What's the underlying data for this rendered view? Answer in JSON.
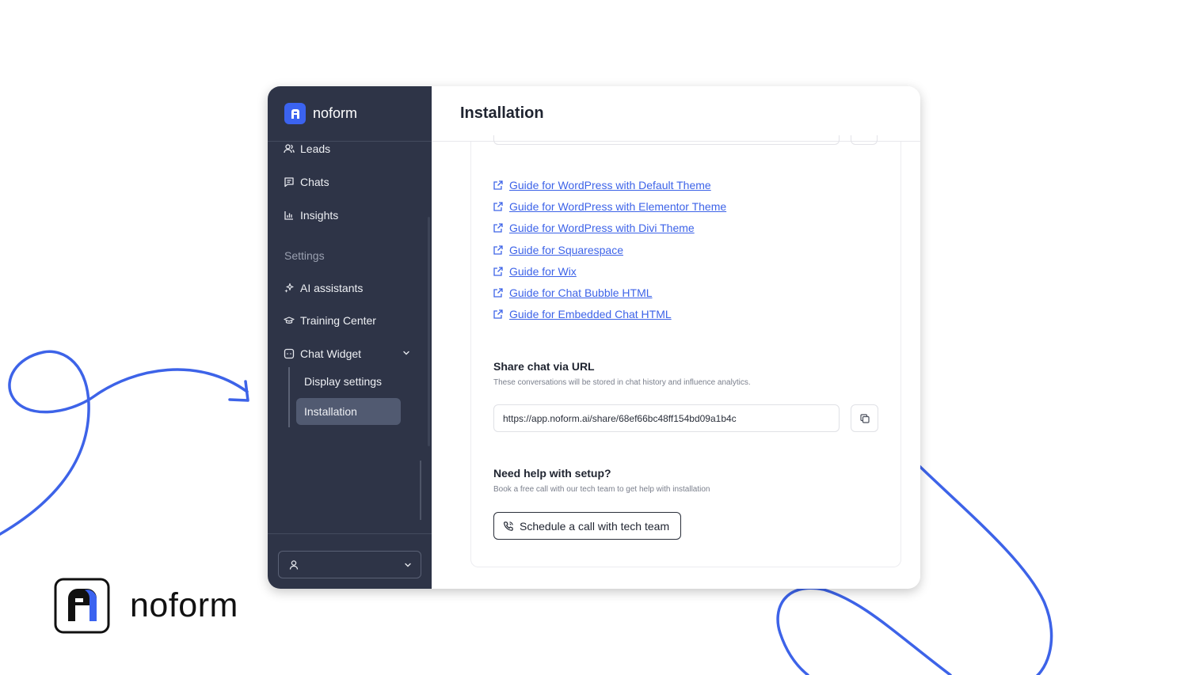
{
  "app": {
    "logo_text": "noform",
    "colors": {
      "sidebar": "#2e3447",
      "accent": "#3b63f0",
      "link": "#3d63e8",
      "decoration": "#3d63e8"
    }
  },
  "sidebar": {
    "nav": [
      {
        "label": "Leads",
        "icon": "users-icon"
      },
      {
        "label": "Chats",
        "icon": "chat-icon"
      },
      {
        "label": "Insights",
        "icon": "bar-chart-icon"
      }
    ],
    "settings_label": "Settings",
    "settings_items": [
      {
        "label": "AI assistants",
        "icon": "sparkles-icon"
      },
      {
        "label": "Training Center",
        "icon": "graduation-cap-icon"
      },
      {
        "label": "Chat Widget",
        "icon": "widget-icon"
      }
    ],
    "chat_widget_sub": [
      {
        "label": "Display settings",
        "active": false
      },
      {
        "label": "Installation",
        "active": true
      }
    ],
    "user_select_icon": "user-icon"
  },
  "main": {
    "title": "Installation",
    "guides": [
      "Guide for WordPress with Default Theme",
      "Guide for WordPress with Elementor Theme",
      "Guide for WordPress with Divi Theme",
      "Guide for Squarespace",
      "Guide for Wix",
      "Guide for Chat Bubble HTML",
      "Guide for Embedded Chat HTML"
    ],
    "share": {
      "title": "Share chat via URL",
      "subtitle": "These conversations will be stored in chat history and influence analytics.",
      "url": "https://app.noform.ai/share/68ef66bc48ff154bd09a1b4c"
    },
    "help": {
      "title": "Need help with setup?",
      "subtitle": "Book a free call with our tech team to get help with installation",
      "button": "Schedule a call with tech team"
    }
  },
  "brand": {
    "text": "noform"
  }
}
